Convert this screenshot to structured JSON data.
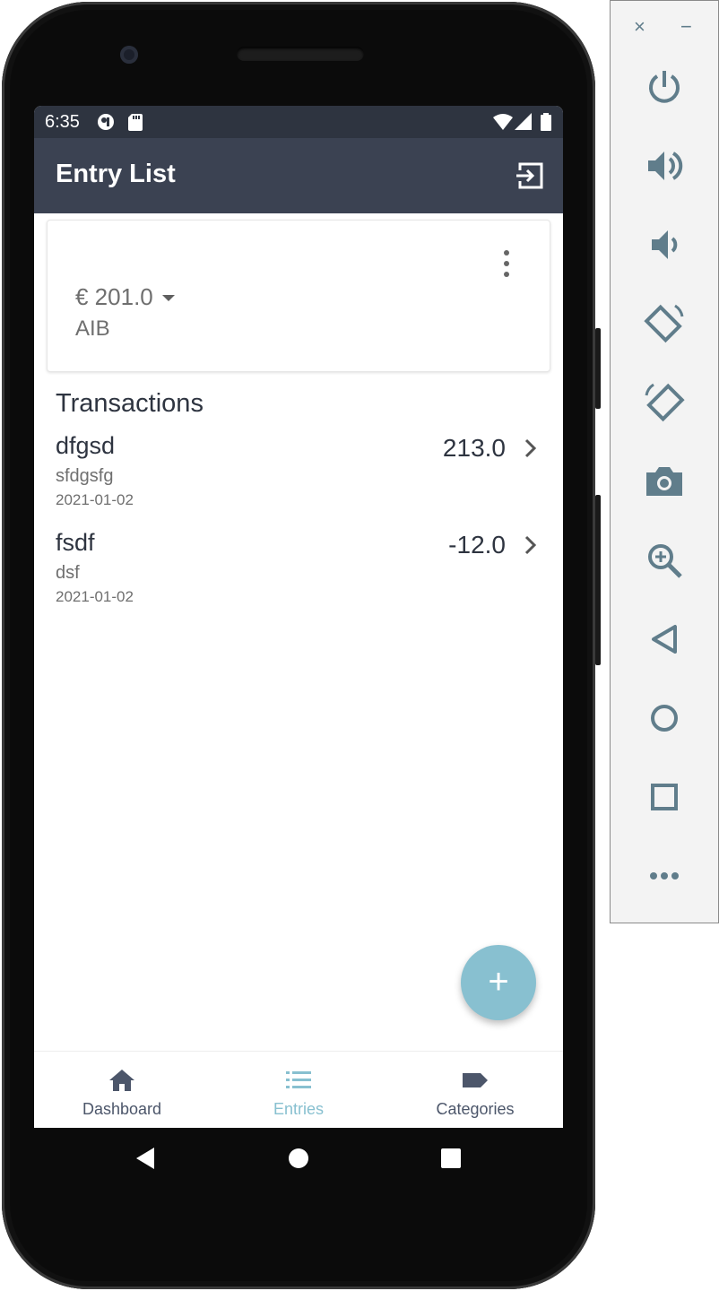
{
  "status_bar": {
    "time": "6:35"
  },
  "app_bar": {
    "title": "Entry List",
    "action_icon": "logout-icon"
  },
  "account_card": {
    "balance": "€ 201.0",
    "bank": "AIB"
  },
  "transactions": {
    "heading": "Transactions",
    "items": [
      {
        "name": "dfgsd",
        "description": "sfdgsfg",
        "date": "2021-01-02",
        "amount": "213.0"
      },
      {
        "name": "fsdf",
        "description": "dsf",
        "date": "2021-01-02",
        "amount": "-12.0"
      }
    ]
  },
  "fab": {
    "label": "+"
  },
  "bottom_nav": {
    "items": [
      {
        "label": "Dashboard",
        "icon": "home-icon",
        "active": false
      },
      {
        "label": "Entries",
        "icon": "list-icon",
        "active": true
      },
      {
        "label": "Categories",
        "icon": "label-icon",
        "active": false
      }
    ]
  },
  "emulator_toolbar": {
    "close": "×",
    "minimize": "−",
    "buttons": [
      "power-icon",
      "volume-up-icon",
      "volume-down-icon",
      "rotate-left-icon",
      "rotate-right-icon",
      "camera-icon",
      "zoom-icon",
      "back-icon",
      "home-icon",
      "overview-icon",
      "more-icon"
    ]
  },
  "colors": {
    "status_bar": "#2e3440",
    "app_bar": "#3b4252",
    "accent": "#88c0d0",
    "toolbar_icon": "#607d8b"
  }
}
